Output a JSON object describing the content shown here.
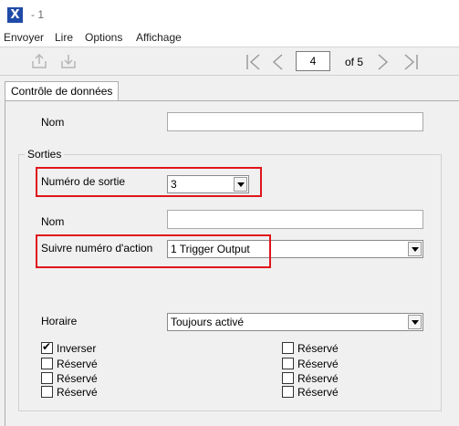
{
  "window": {
    "title": "- 1"
  },
  "menu": [
    "Envoyer",
    "Lire",
    "Options",
    "Affichage"
  ],
  "toolbar": {
    "icons": [
      "upload-icon",
      "download-icon"
    ],
    "nav": {
      "page": "4",
      "of_label": "of 5"
    }
  },
  "tab": {
    "label": "Contrôle de données"
  },
  "form": {
    "nom_label": "Nom",
    "nom_value": "",
    "sorties": {
      "legend": "Sorties",
      "numero_label": "Numéro de sortie",
      "numero_value": "3",
      "nom_label": "Nom",
      "nom_value": "",
      "action_label": "Suivre numéro d'action",
      "action_value": "1 Trigger Output",
      "horaire_label": "Horaire",
      "horaire_value": "Toujours activé"
    },
    "checkboxes_left": [
      {
        "label": "Inverser",
        "checked": true
      },
      {
        "label": "Réservé",
        "checked": false
      },
      {
        "label": "Réservé",
        "checked": false
      },
      {
        "label": "Réservé",
        "checked": false
      }
    ],
    "checkboxes_right": [
      {
        "label": "Réservé",
        "checked": false
      },
      {
        "label": "Réservé",
        "checked": false
      },
      {
        "label": "Réservé",
        "checked": false
      },
      {
        "label": "Réservé",
        "checked": false
      }
    ]
  },
  "colors": {
    "highlight": "#e0151b",
    "app_icon": "#1f4aa8"
  }
}
